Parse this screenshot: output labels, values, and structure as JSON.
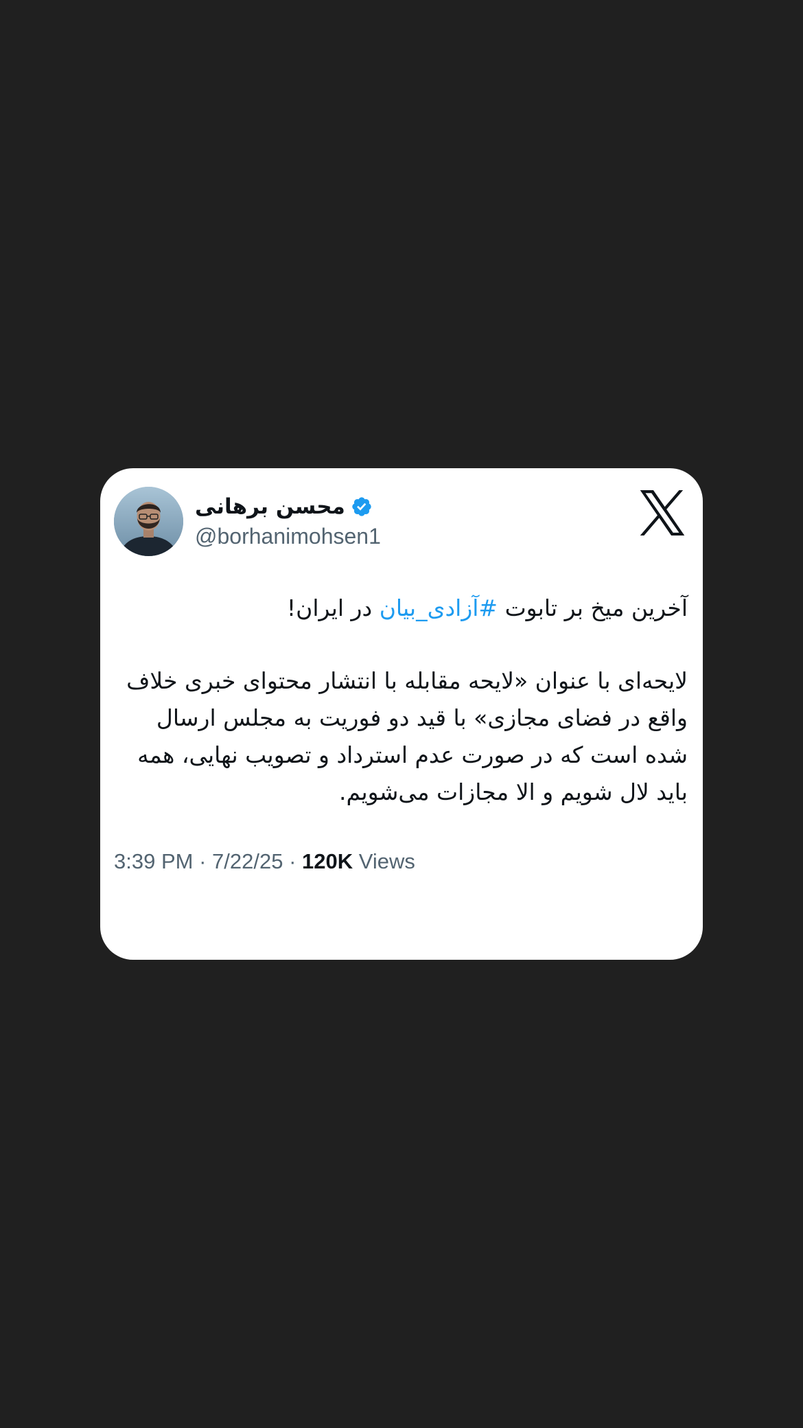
{
  "tweet": {
    "author_name": "محسن برهانی",
    "handle": "@borhanimohsen1",
    "verified": true,
    "line1_before": "آخرین میخ بر تابوت ",
    "hashtag": "#آزادی_بیان",
    "line1_after": " در ایران!",
    "paragraph2": "لایحه‌ای با عنوان «لایحه مقابله با انتشار محتوای خبری خلاف واقع در فضای مجازی» با قید دو فوریت به مجلس ارسال شده است که در صورت عدم استرداد و تصویب نهایی، همه باید لال شویم و الا مجازات می‌شویم.",
    "time": "3:39 PM",
    "date": "7/22/25",
    "separator": "·",
    "views_count": "120K",
    "views_label": "Views"
  },
  "colors": {
    "background": "#202020",
    "card": "#ffffff",
    "text": "#0f1419",
    "muted": "#536471",
    "accent": "#1d9bf0"
  },
  "icons": {
    "brand": "x-logo-icon",
    "verified": "verified-badge-icon"
  }
}
